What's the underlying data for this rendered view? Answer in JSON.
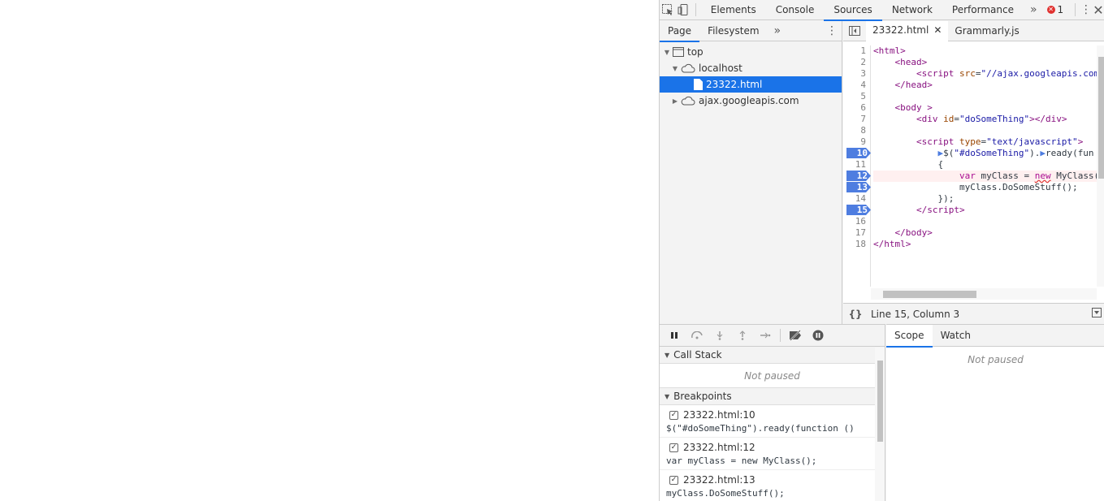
{
  "devtools": {
    "tabs": [
      "Elements",
      "Console",
      "Sources",
      "Network",
      "Performance"
    ],
    "active_tab": "Sources",
    "error_count": "1"
  },
  "navigator": {
    "tabs": [
      "Page",
      "Filesystem"
    ],
    "tree": {
      "top": "top",
      "localhost": "localhost",
      "file": "23322.html",
      "ajax": "ajax.googleapis.com"
    }
  },
  "editor": {
    "tabs": [
      "23322.html",
      "Grammarly.js"
    ],
    "lines": [
      {
        "n": "1",
        "bp": false
      },
      {
        "n": "2",
        "bp": false
      },
      {
        "n": "3",
        "bp": false
      },
      {
        "n": "4",
        "bp": false
      },
      {
        "n": "5",
        "bp": false
      },
      {
        "n": "6",
        "bp": false
      },
      {
        "n": "7",
        "bp": false
      },
      {
        "n": "8",
        "bp": false
      },
      {
        "n": "9",
        "bp": false
      },
      {
        "n": "10",
        "bp": true
      },
      {
        "n": "11",
        "bp": false
      },
      {
        "n": "12",
        "bp": true
      },
      {
        "n": "13",
        "bp": true
      },
      {
        "n": "14",
        "bp": false
      },
      {
        "n": "15",
        "bp": true
      },
      {
        "n": "16",
        "bp": false
      },
      {
        "n": "17",
        "bp": false
      },
      {
        "n": "18",
        "bp": false
      }
    ],
    "status": "Line 15, Column 3",
    "format_label": "{}"
  },
  "debugger": {
    "call_stack_label": "Call Stack",
    "call_stack_empty": "Not paused",
    "breakpoints_label": "Breakpoints",
    "breakpoints": [
      {
        "loc": "23322.html:10",
        "code": "$(\"#doSomeThing\").ready(function ()"
      },
      {
        "loc": "23322.html:12",
        "code": "var myClass = new MyClass();"
      },
      {
        "loc": "23322.html:13",
        "code": "myClass.DoSomeStuff();"
      }
    ]
  },
  "scope": {
    "tabs": [
      "Scope",
      "Watch"
    ],
    "empty": "Not paused"
  }
}
